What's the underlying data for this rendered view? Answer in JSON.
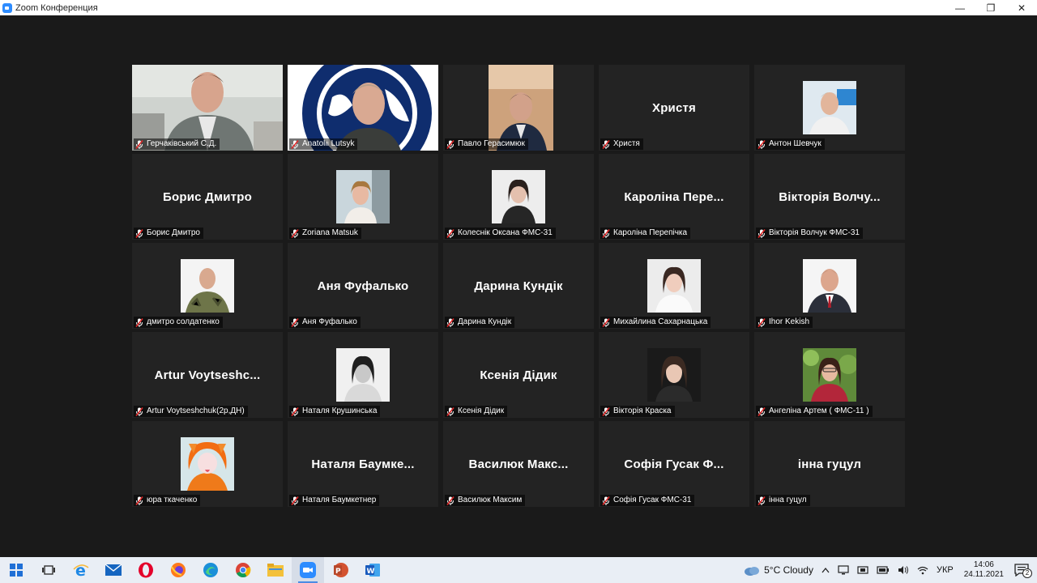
{
  "window": {
    "title": "Zoom Конференция",
    "min": "—",
    "max": "❐",
    "close": "✕"
  },
  "tiles": [
    {
      "label": "Герчаківський С.Д.",
      "kind": "video"
    },
    {
      "label": "Anatolii Lutsyk",
      "kind": "video"
    },
    {
      "label": "Павло Герасимюк",
      "kind": "video",
      "active": true
    },
    {
      "label": "Христя",
      "display": "Христя",
      "kind": "name"
    },
    {
      "label": "Антон Шевчук",
      "kind": "photo"
    },
    {
      "label": "Борис Дмитро",
      "display": "Борис Дмитро",
      "kind": "name"
    },
    {
      "label": "Zoriana Matsuk",
      "kind": "photo"
    },
    {
      "label": "Колеснік Оксана ФМС-31",
      "kind": "photo"
    },
    {
      "label": "Кароліна Перепічка",
      "display": "Кароліна Пере...",
      "kind": "name"
    },
    {
      "label": "Вікторія Волчук ФМС-31",
      "display": "Вікторія Волчу...",
      "kind": "name"
    },
    {
      "label": "дмитро солдатенко",
      "kind": "photo"
    },
    {
      "label": "Аня Фуфалько",
      "display": "Аня Фуфалько",
      "kind": "name"
    },
    {
      "label": "Дарина Кундік",
      "display": "Дарина Кундік",
      "kind": "name"
    },
    {
      "label": "Михайлина Сахарнацька",
      "kind": "photo"
    },
    {
      "label": "Ihor Kekish",
      "kind": "photo"
    },
    {
      "label": "Artur Voytseshchuk(2р,ДН)",
      "display": "Artur Voytseshc...",
      "kind": "name"
    },
    {
      "label": "Наталя Крушинська",
      "kind": "photo"
    },
    {
      "label": "Ксенія Дідик",
      "display": "Ксенія Дідик",
      "kind": "name"
    },
    {
      "label": "Вікторія Краска",
      "kind": "photo"
    },
    {
      "label": "Ангеліна Артем ( ФМС-11 )",
      "kind": "photo"
    },
    {
      "label": "юра ткаченко",
      "kind": "photo"
    },
    {
      "label": "Наталя Баумкетнер",
      "display": "Наталя Баумке...",
      "kind": "name"
    },
    {
      "label": "Василюк Максим",
      "display": "Василюк Макс...",
      "kind": "name"
    },
    {
      "label": "Софія Гусак ФМС-31",
      "display": "Софія Гусак Ф...",
      "kind": "name"
    },
    {
      "label": "інна гуцул",
      "display": "інна гуцул",
      "kind": "name"
    }
  ],
  "taskbar": {
    "weather": "5°C  Cloudy",
    "lang": "УКР",
    "time": "14:06",
    "date": "24.11.2021",
    "notifications": "2"
  }
}
